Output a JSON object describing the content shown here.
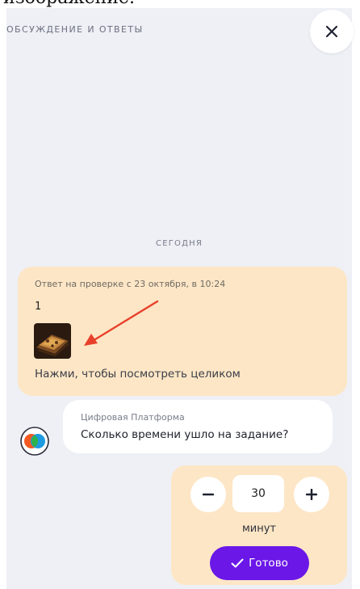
{
  "top_caption": "изображение.",
  "header": {
    "title": "ОБСУЖДЕНИЕ И ОТВЕТЫ",
    "close_icon": "close-icon"
  },
  "day_separator": "СЕГОДНЯ",
  "answer": {
    "meta": "Ответ на проверке с 23 октября, в 10:24",
    "text": "1",
    "view_full": "Нажми, чтобы посмотреть целиком",
    "arrow_color": "#e8402a"
  },
  "bot_message": {
    "sender": "Цифровая Платформа",
    "text": "Сколько времени ушло на задание?"
  },
  "time_form": {
    "minus_icon": "minus-icon",
    "plus_icon": "plus-icon",
    "value": "30",
    "unit": "минут",
    "done_label": "Готово",
    "accent": "#6a17e8"
  },
  "colors": {
    "panel_bg": "#eef0f5",
    "card_bg": "#fde6c6",
    "bubble_bg": "#ffffff"
  }
}
